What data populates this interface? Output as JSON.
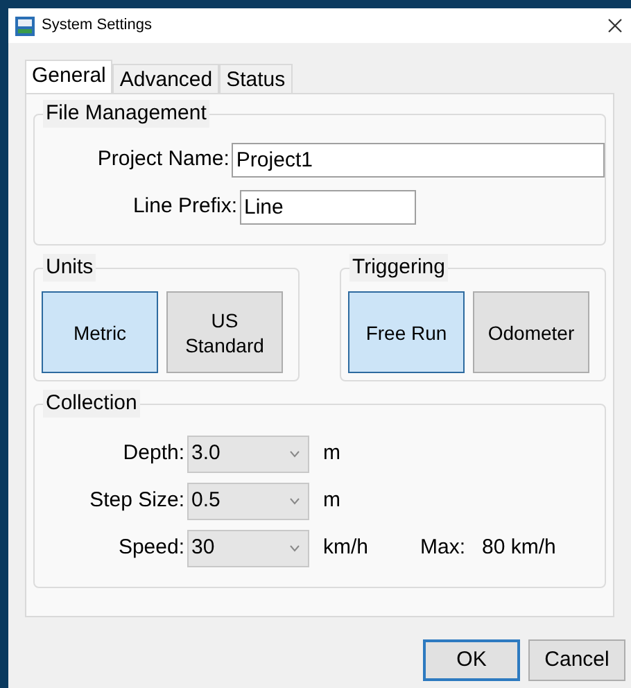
{
  "window": {
    "title": "System Settings"
  },
  "tabs": [
    {
      "label": "General",
      "selected": true
    },
    {
      "label": "Advanced",
      "selected": false
    },
    {
      "label": "Status",
      "selected": false
    }
  ],
  "file_management": {
    "title": "File Management",
    "fields": [
      {
        "label": "Project Name:",
        "value": "Project1"
      },
      {
        "label": "Line Prefix:",
        "value": "Line"
      }
    ]
  },
  "units": {
    "title": "Units",
    "options": [
      {
        "label": "Metric",
        "selected": true
      },
      {
        "label": "US Standard",
        "selected": false
      }
    ]
  },
  "triggering": {
    "title": "Triggering",
    "options": [
      {
        "label": "Free Run",
        "selected": true
      },
      {
        "label": "Odometer",
        "selected": false
      }
    ]
  },
  "collection": {
    "title": "Collection",
    "rows": [
      {
        "label": "Depth:",
        "value": "3.0",
        "unit": "m"
      },
      {
        "label": "Step Size:",
        "value": "0.5",
        "unit": "m"
      },
      {
        "label": "Speed:",
        "value": "30",
        "unit": "km/h"
      }
    ],
    "max_label": "Max:",
    "max_value": "80 km/h"
  },
  "buttons": [
    {
      "label": "OK",
      "default": true
    },
    {
      "label": "Cancel",
      "default": false
    }
  ]
}
